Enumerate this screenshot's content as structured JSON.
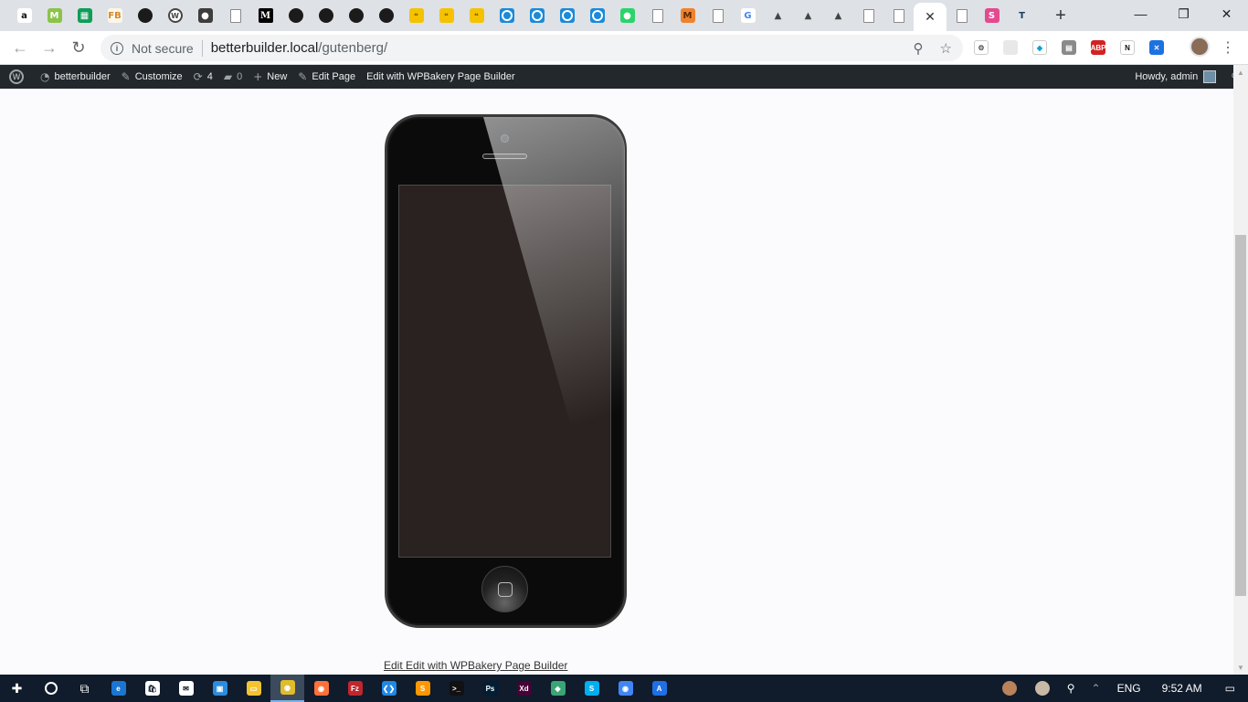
{
  "browser": {
    "tabs": [
      {
        "icon": "amazon-icon",
        "glyph": "a",
        "color": "#ffffff",
        "fg": "#111111"
      },
      {
        "icon": "m-green-icon",
        "glyph": "M",
        "color": "#8bc34a",
        "fg": "#ffffff"
      },
      {
        "icon": "sheets-icon",
        "glyph": "▦",
        "color": "#0f9d58",
        "fg": "#ffffff"
      },
      {
        "icon": "fb-icon",
        "glyph": "FB",
        "color": "#fdf6e9",
        "fg": "#d08a2a"
      },
      {
        "icon": "github-icon",
        "glyph": "",
        "kind": "gh"
      },
      {
        "icon": "wordpress-icon",
        "glyph": "W",
        "kind": "wp"
      },
      {
        "icon": "gitkraken-icon",
        "glyph": "●",
        "color": "#3d3d3d",
        "fg": "#ffffff"
      },
      {
        "icon": "page-icon",
        "kind": "page"
      },
      {
        "icon": "medium-icon",
        "glyph": "M",
        "kind": "md"
      },
      {
        "icon": "github-icon",
        "kind": "gh"
      },
      {
        "icon": "github-icon",
        "kind": "gh"
      },
      {
        "icon": "github-icon",
        "kind": "gh"
      },
      {
        "icon": "github-icon",
        "kind": "gh"
      },
      {
        "icon": "quote-icon",
        "glyph": "❝",
        "kind": "yel"
      },
      {
        "icon": "quote-icon",
        "glyph": "❝",
        "kind": "yel"
      },
      {
        "icon": "quote-icon",
        "glyph": "❝",
        "kind": "yel"
      },
      {
        "icon": "target-icon",
        "kind": "blue"
      },
      {
        "icon": "target-icon",
        "kind": "blue"
      },
      {
        "icon": "target-icon",
        "kind": "blue"
      },
      {
        "icon": "target-icon",
        "kind": "blue"
      },
      {
        "icon": "line-icon",
        "glyph": "●",
        "color": "#2bd46a",
        "fg": "#ffffff"
      },
      {
        "icon": "page-icon",
        "kind": "page"
      },
      {
        "icon": "m-orange-icon",
        "glyph": "M",
        "color": "#f0822e",
        "fg": "#5a2a00"
      },
      {
        "icon": "page-icon",
        "kind": "page"
      },
      {
        "icon": "google-icon",
        "glyph": "G",
        "color": "#ffffff",
        "fg": "#4285f4"
      },
      {
        "icon": "triangle-icon",
        "glyph": "▲",
        "color": "#dee1e6",
        "fg": "#444444"
      },
      {
        "icon": "triangle-icon",
        "glyph": "▲",
        "color": "#dee1e6",
        "fg": "#444444"
      },
      {
        "icon": "triangle-icon",
        "glyph": "▲",
        "color": "#dee1e6",
        "fg": "#444444"
      },
      {
        "icon": "page-icon",
        "kind": "page"
      },
      {
        "icon": "page-icon",
        "kind": "page"
      },
      {
        "icon": "close-icon",
        "active": true
      },
      {
        "icon": "page-icon",
        "kind": "page"
      },
      {
        "icon": "pink-icon",
        "glyph": "S",
        "color": "#e34a8f",
        "fg": "#ffffff"
      },
      {
        "icon": "t-icon",
        "glyph": "T",
        "color": "#dee1e6",
        "fg": "#1a3b5c"
      }
    ],
    "new_tab": "+",
    "security_label": "Not secure",
    "url_host": "betterbuilder.local",
    "url_path": "/gutenberg/",
    "extensions": [
      {
        "icon": "gear-ext-icon",
        "glyph": "⚙",
        "color": "#ffffff",
        "fg": "#555555"
      },
      {
        "icon": "blank-ext-icon",
        "glyph": "",
        "color": "#e8e8e8",
        "fg": "#999999"
      },
      {
        "icon": "tag-ext-icon",
        "glyph": "◆",
        "color": "#ffffff",
        "fg": "#00a3d9"
      },
      {
        "icon": "gray-ext-icon",
        "glyph": "▤",
        "color": "#8a8a8a",
        "fg": "#ffffff"
      },
      {
        "icon": "abp-icon",
        "glyph": "ABP",
        "color": "#d22222",
        "fg": "#ffffff"
      },
      {
        "icon": "notion-ext-icon",
        "glyph": "N",
        "color": "#ffffff",
        "fg": "#111111"
      },
      {
        "icon": "x-ext-icon",
        "glyph": "✕",
        "color": "#1c72e0",
        "fg": "#ffffff"
      }
    ]
  },
  "adminbar": {
    "site_name": "betterbuilder",
    "customize": "Customize",
    "updates_count": "4",
    "comments_count": "0",
    "new": "New",
    "edit_page": "Edit Page",
    "edit_wpbakery": "Edit with WPBakery Page Builder",
    "howdy": "Howdy, admin"
  },
  "page": {
    "edit_link": "Edit Edit with WPBakery Page Builder"
  },
  "taskbar": {
    "apps": [
      {
        "icon": "edge-icon",
        "glyph": "e",
        "color": "#1a76d2"
      },
      {
        "icon": "store-icon",
        "glyph": "🛍",
        "color": "#ffffff"
      },
      {
        "icon": "mail-icon",
        "glyph": "✉",
        "color": "#ffffff"
      },
      {
        "icon": "photos-icon",
        "glyph": "▣",
        "color": "#2a8ce0"
      },
      {
        "icon": "explorer-icon",
        "glyph": "▭",
        "color": "#f4c430"
      },
      {
        "icon": "chrome-icon",
        "glyph": "◉",
        "color": "#e0bb2b",
        "active": true
      },
      {
        "icon": "firefox-icon",
        "glyph": "◉",
        "color": "#ff7139"
      },
      {
        "icon": "filezilla-icon",
        "glyph": "Fz",
        "color": "#c0272d"
      },
      {
        "icon": "vscode-icon",
        "glyph": "❮❯",
        "color": "#1e88e5"
      },
      {
        "icon": "sublime-icon",
        "glyph": "S",
        "color": "#ff9800"
      },
      {
        "icon": "terminal-icon",
        "glyph": ">_",
        "color": "#111111"
      },
      {
        "icon": "photoshop-icon",
        "glyph": "Ps",
        "color": "#001e36"
      },
      {
        "icon": "xd-icon",
        "glyph": "Xd",
        "color": "#470137"
      },
      {
        "icon": "diamond-icon",
        "glyph": "◆",
        "color": "#3aa675"
      },
      {
        "icon": "skype-icon",
        "glyph": "S",
        "color": "#00aff0"
      },
      {
        "icon": "chrome-alt-icon",
        "glyph": "◉",
        "color": "#4285f4"
      },
      {
        "icon": "a-icon",
        "glyph": "A",
        "color": "#1f6fe5"
      }
    ],
    "lang": "ENG",
    "time": "9:52 AM"
  }
}
